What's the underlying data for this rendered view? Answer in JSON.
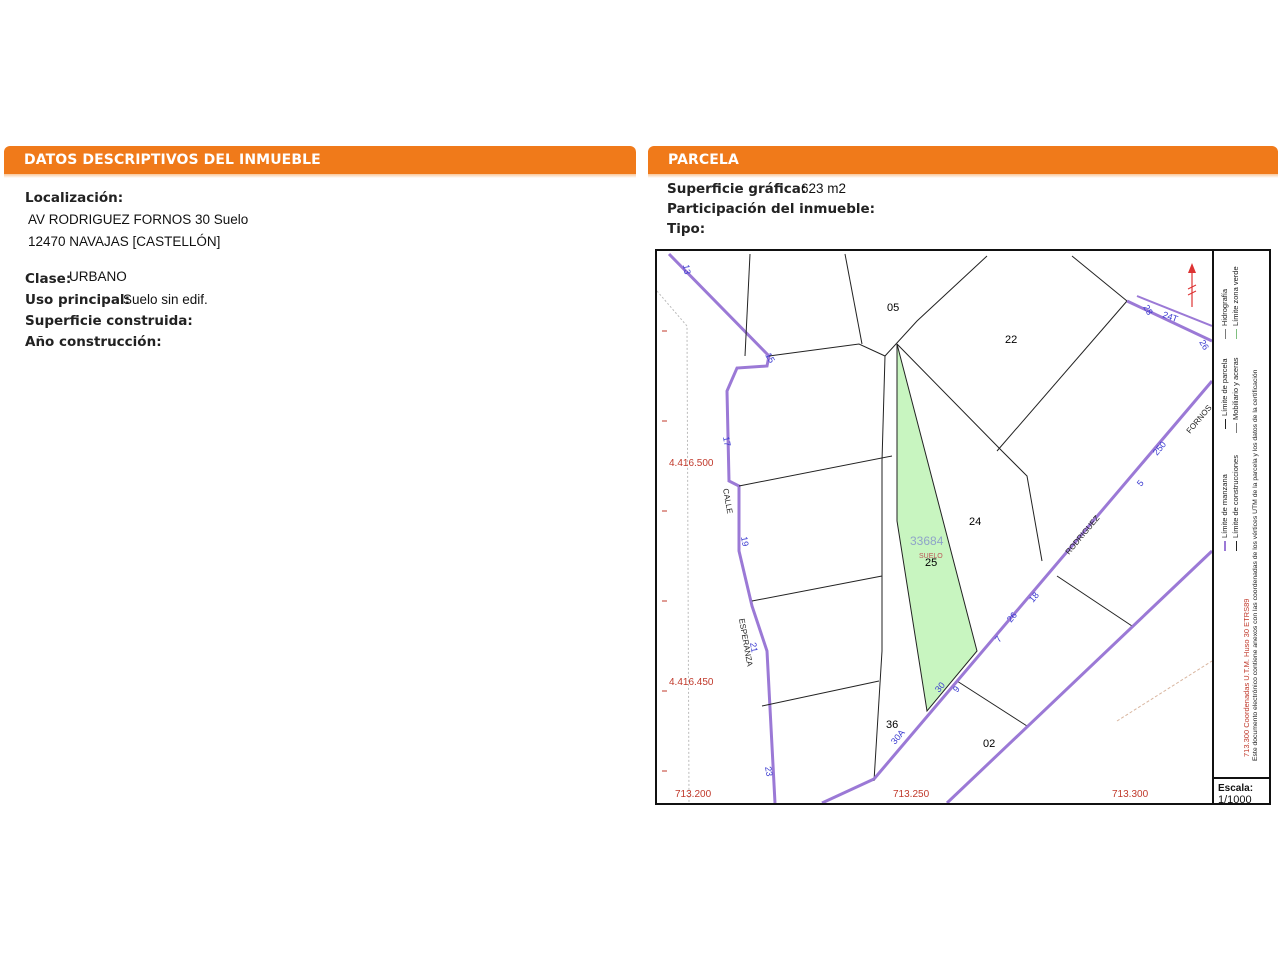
{
  "left_panel": {
    "title": "DATOS DESCRIPTIVOS DEL INMUEBLE",
    "localizacion_label": "Localización:",
    "address_line1": "AV RODRIGUEZ FORNOS 30 Suelo",
    "address_line2": "12470 NAVAJAS [CASTELLÓN]",
    "clase_label": "Clase:",
    "clase_value": "URBANO",
    "uso_label": "Uso principal:",
    "uso_value": "Suelo sin edif.",
    "superficie_construida_label": "Superficie construida:",
    "ano_label": "Año construcción:"
  },
  "right_panel": {
    "title": "PARCELA",
    "superficie_grafica_label": "Superficie gráfica:",
    "superficie_grafica_value": "623 m2",
    "participacion_label": "Participación del inmueble:",
    "tipo_label": "Tipo:"
  },
  "map": {
    "parcel_ids": [
      "05",
      "22",
      "24",
      "25",
      "36",
      "02"
    ],
    "parcel_ref": "33684",
    "parcel_suelo": "SUELO",
    "street_numbers": [
      "13",
      "15",
      "17",
      "19",
      "21",
      "23",
      "28",
      "24T",
      "26",
      "30",
      "30A",
      "7",
      "26",
      "18",
      "5",
      "250",
      "9"
    ],
    "street_names": [
      "CALLE",
      "ESPERANZA",
      "RODRIGUEZ",
      "FORNOS"
    ],
    "coord_y_top": "4.416.500",
    "coord_y_bottom": "4.416.450",
    "coord_x_left": "713.200",
    "coord_x_mid": "713.250",
    "coord_x_right": "713.300",
    "scale_label": "Escala:",
    "scale_value": "1/1000",
    "legend": {
      "limite_manzana": "Límite de manzana",
      "limite_parcela": "Límite de parcela",
      "hidrografia": "Hidrografía",
      "limite_construcciones": "Límite de construcciones",
      "mobiliario": "Mobiliario y aceras",
      "limite_zona_verde": "Límite zona verde",
      "coords_note": "713.300 Coordenadas U.T.M. Huso 30 ETRS89",
      "doc_note": "Este documento electrónico contiene anexos con las coordenadas de los vértices UTM de la parcela y los datos de la certificación"
    }
  },
  "colors": {
    "header_orange": "#f07a1a",
    "parcel_green": "#c8f5c0",
    "boundary_purple": "#9b79d6",
    "coord_red": "#c0392b"
  }
}
